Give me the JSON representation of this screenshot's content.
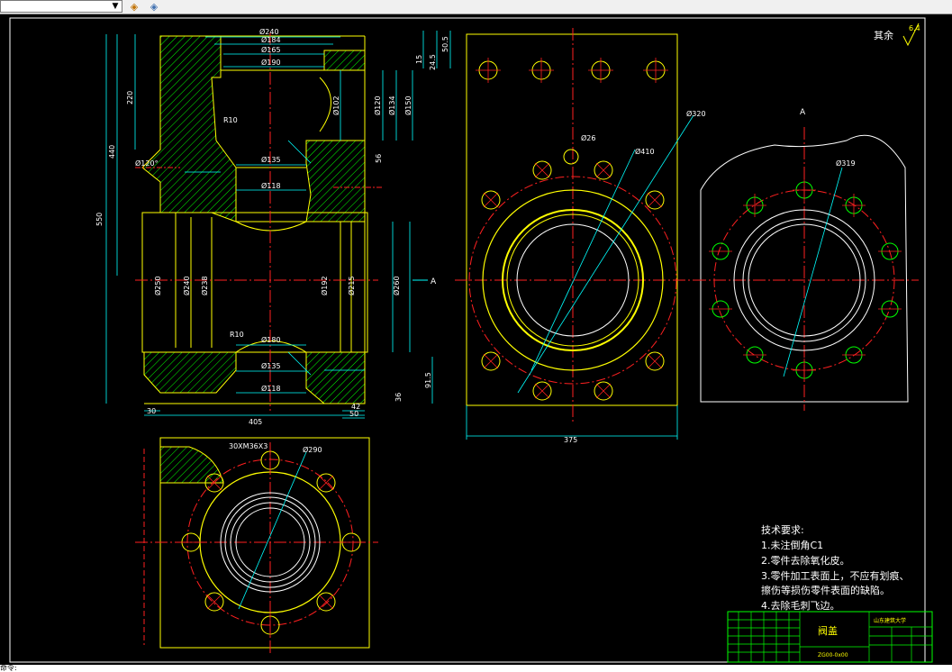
{
  "toolbar": {
    "layer_combo_value": "",
    "icons": [
      "layer-states-icon",
      "layer-manager-icon"
    ]
  },
  "drawing": {
    "surface_roughness": "其余",
    "roughness_value": "6.4",
    "section_marker": "A",
    "dims": {
      "d240": "Ø240",
      "d184": "Ø184",
      "d165": "Ø165",
      "d190": "Ø190",
      "d102": "Ø102",
      "d120": "Ø120",
      "d134": "Ø134",
      "d150": "Ø150",
      "d135a": "Ø135",
      "d118a": "Ø118",
      "d250": "Ø250",
      "d240b": "Ø240",
      "d238": "Ø238",
      "d192": "Ø192",
      "d215": "Ø215",
      "d260": "Ø260",
      "d180": "Ø180",
      "d135b": "Ø135",
      "d118b": "Ø118",
      "r10a": "R10",
      "r10b": "R10",
      "a120": "Ø120°",
      "h550": "550",
      "h440": "440",
      "h220": "220",
      "h15": "15",
      "h245": "24.5",
      "h505": "50.5",
      "h56": "56",
      "h36": "36",
      "h915": "91.5",
      "w30": "30",
      "w405": "405",
      "w50": "50",
      "w42": "42",
      "w375": "375",
      "d320": "Ø320",
      "d26": "Ø26",
      "d410": "Ø410",
      "d319": "Ø319",
      "thread": "30XM36X3",
      "d290": "Ø290"
    },
    "notes": {
      "title": "技术要求:",
      "items": [
        "1.未注倒角C1",
        "2.零件去除氧化皮。",
        "3.零件加工表面上，不应有划痕、",
        "擦伤等损伤零件表面的缺陷。",
        "4.去除毛刺飞边。"
      ]
    },
    "title_block": {
      "part_name": "阀盖",
      "school": "山东建筑大学",
      "code": "ZG00-0x00"
    }
  },
  "colors": {
    "outline": "#ffff00",
    "center": "#ff2020",
    "dimension": "#00ffff",
    "hatch": "#00ff00",
    "text": "#ffffff"
  },
  "command_line": "命令:"
}
